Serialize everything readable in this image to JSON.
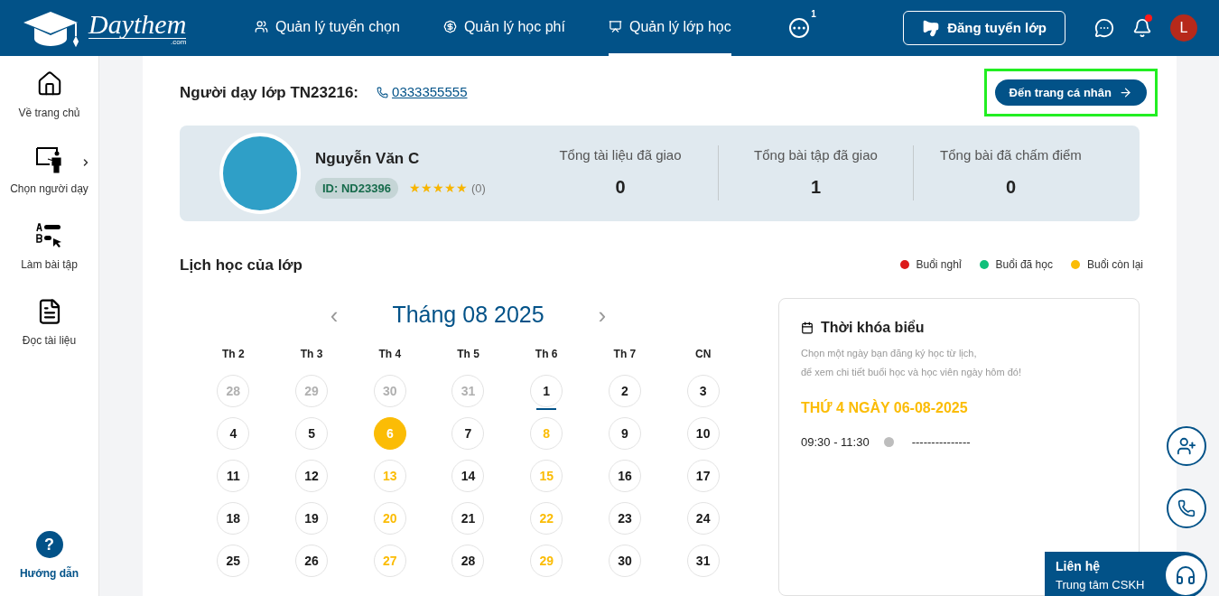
{
  "header": {
    "logo": {
      "name": "Daythem",
      "suffix": ".com"
    },
    "nav": [
      {
        "label": "Quản lý tuyển chọn",
        "selected": false
      },
      {
        "label": "Quản lý học phí",
        "selected": false
      },
      {
        "label": "Quản lý lớp học",
        "selected": true
      }
    ],
    "more_badge": "1",
    "post_button": "Đăng tuyển lớp",
    "avatar": "L",
    "notification_dot": true
  },
  "sidebar": {
    "items": [
      {
        "label": "Về trang chủ",
        "has_submenu": false
      },
      {
        "label": "Chọn người dạy",
        "has_submenu": true
      },
      {
        "label": "Làm bài tập",
        "has_submenu": false
      },
      {
        "label": "Đọc tài liệu",
        "has_submenu": false
      }
    ],
    "help_icon": "?",
    "help": "Hướng dẫn"
  },
  "teacher_section": {
    "title": "Người dạy lớp TN23216:",
    "phone": "0333355555",
    "profile_button": "Đến trang cá nhân",
    "highlighted": true
  },
  "teacher_card": {
    "name": "Nguyễn Văn C",
    "id_badge": "ID: ND23396",
    "stars": 5,
    "rating_count": "(0)",
    "stats": [
      {
        "label": "Tổng tài liệu đã giao",
        "value": "0"
      },
      {
        "label": "Tổng bài tập đã giao",
        "value": "1"
      },
      {
        "label": "Tổng bài đã chấm điểm",
        "value": "0"
      }
    ]
  },
  "schedule": {
    "title": "Lịch học của lớp",
    "legend": [
      {
        "label": "Buổi nghỉ",
        "color": "#dc1a1a"
      },
      {
        "label": "Buổi đã học",
        "color": "#10c07a"
      },
      {
        "label": "Buổi còn lại",
        "color": "#fbbc05"
      }
    ],
    "calendar": {
      "prev": "‹",
      "month": "Tháng 08 2025",
      "next": "›",
      "weekdays": [
        "Th 2",
        "Th 3",
        "Th 4",
        "Th 5",
        "Th 6",
        "Th 7",
        "CN"
      ],
      "days": [
        {
          "label": "28",
          "kind": "other",
          "selected": false,
          "today": false
        },
        {
          "label": "29",
          "kind": "other",
          "selected": false,
          "today": false
        },
        {
          "label": "30",
          "kind": "other",
          "selected": false,
          "today": false
        },
        {
          "label": "31",
          "kind": "other",
          "selected": false,
          "today": false
        },
        {
          "label": "1",
          "kind": "normal",
          "selected": false,
          "today": true
        },
        {
          "label": "2",
          "kind": "normal",
          "selected": false,
          "today": false
        },
        {
          "label": "3",
          "kind": "normal",
          "selected": false,
          "today": false
        },
        {
          "label": "4",
          "kind": "normal",
          "selected": false,
          "today": false
        },
        {
          "label": "5",
          "kind": "normal",
          "selected": false,
          "today": false
        },
        {
          "label": "6",
          "kind": "remaining",
          "selected": true,
          "today": false
        },
        {
          "label": "7",
          "kind": "normal",
          "selected": false,
          "today": false
        },
        {
          "label": "8",
          "kind": "remaining",
          "selected": false,
          "today": false
        },
        {
          "label": "9",
          "kind": "normal",
          "selected": false,
          "today": false
        },
        {
          "label": "10",
          "kind": "normal",
          "selected": false,
          "today": false
        },
        {
          "label": "11",
          "kind": "normal",
          "selected": false,
          "today": false
        },
        {
          "label": "12",
          "kind": "normal",
          "selected": false,
          "today": false
        },
        {
          "label": "13",
          "kind": "remaining",
          "selected": false,
          "today": false
        },
        {
          "label": "14",
          "kind": "normal",
          "selected": false,
          "today": false
        },
        {
          "label": "15",
          "kind": "remaining",
          "selected": false,
          "today": false
        },
        {
          "label": "16",
          "kind": "normal",
          "selected": false,
          "today": false
        },
        {
          "label": "17",
          "kind": "normal",
          "selected": false,
          "today": false
        },
        {
          "label": "18",
          "kind": "normal",
          "selected": false,
          "today": false
        },
        {
          "label": "19",
          "kind": "normal",
          "selected": false,
          "today": false
        },
        {
          "label": "20",
          "kind": "remaining",
          "selected": false,
          "today": false
        },
        {
          "label": "21",
          "kind": "normal",
          "selected": false,
          "today": false
        },
        {
          "label": "22",
          "kind": "remaining",
          "selected": false,
          "today": false
        },
        {
          "label": "23",
          "kind": "normal",
          "selected": false,
          "today": false
        },
        {
          "label": "24",
          "kind": "normal",
          "selected": false,
          "today": false
        },
        {
          "label": "25",
          "kind": "normal",
          "selected": false,
          "today": false
        },
        {
          "label": "26",
          "kind": "normal",
          "selected": false,
          "today": false
        },
        {
          "label": "27",
          "kind": "remaining",
          "selected": false,
          "today": false
        },
        {
          "label": "28",
          "kind": "normal",
          "selected": false,
          "today": false
        },
        {
          "label": "29",
          "kind": "remaining",
          "selected": false,
          "today": false
        },
        {
          "label": "30",
          "kind": "normal",
          "selected": false,
          "today": false
        },
        {
          "label": "31",
          "kind": "normal",
          "selected": false,
          "today": false
        }
      ]
    },
    "timetable": {
      "title": "Thời khóa biểu",
      "hint": "Chọn một ngày bạn đăng ký học từ lịch,",
      "hint_2": "để xem chi tiết buổi học và học viên ngày hôm đó!",
      "date": "THỨ 4 NGÀY 06-08-2025",
      "sessions": [
        {
          "time": "09:30 - 11:30",
          "color": "#bdbdbd",
          "detail": "---------------"
        }
      ]
    }
  },
  "contact": {
    "title": "Liên hệ",
    "subtitle": "Trung tâm CSKH"
  }
}
